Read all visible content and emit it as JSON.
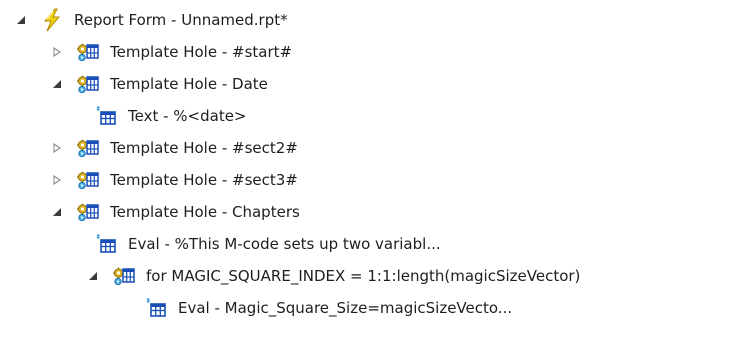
{
  "tree": {
    "root": {
      "label": "Report Form - Unnamed.rpt*",
      "icon": "lightning-icon",
      "state": "expanded"
    },
    "items": [
      {
        "label": "Template Hole - #start#",
        "icon": "template-hole-icon",
        "state": "collapsed"
      },
      {
        "label": "Template Hole - Date",
        "icon": "template-hole-icon",
        "state": "expanded"
      },
      {
        "label": "Text - %<date>",
        "icon": "table-node-icon",
        "state": "leaf"
      },
      {
        "label": "Template Hole - #sect2#",
        "icon": "template-hole-icon",
        "state": "collapsed"
      },
      {
        "label": "Template Hole - #sect3#",
        "icon": "template-hole-icon",
        "state": "collapsed"
      },
      {
        "label": "Template Hole - Chapters",
        "icon": "template-hole-icon",
        "state": "expanded"
      },
      {
        "label": "Eval - %This M-code sets up two variabl...",
        "icon": "table-node-icon",
        "state": "leaf"
      },
      {
        "label": "for MAGIC_SQUARE_INDEX = 1:1:length(magicSizeVector)",
        "icon": "template-hole-icon",
        "state": "expanded"
      },
      {
        "label": "Eval - Magic_Square_Size=magicSizeVecto...",
        "icon": "table-node-icon",
        "state": "leaf"
      }
    ]
  },
  "colors": {
    "text": "#1e1e1e",
    "arrow_expanded": "#3c3c3c",
    "arrow_collapsed": "#8a8a8a",
    "lightning": "#e8c40a",
    "grid_blue": "#1a4fb8",
    "gear_yellow": "#d9b020"
  }
}
